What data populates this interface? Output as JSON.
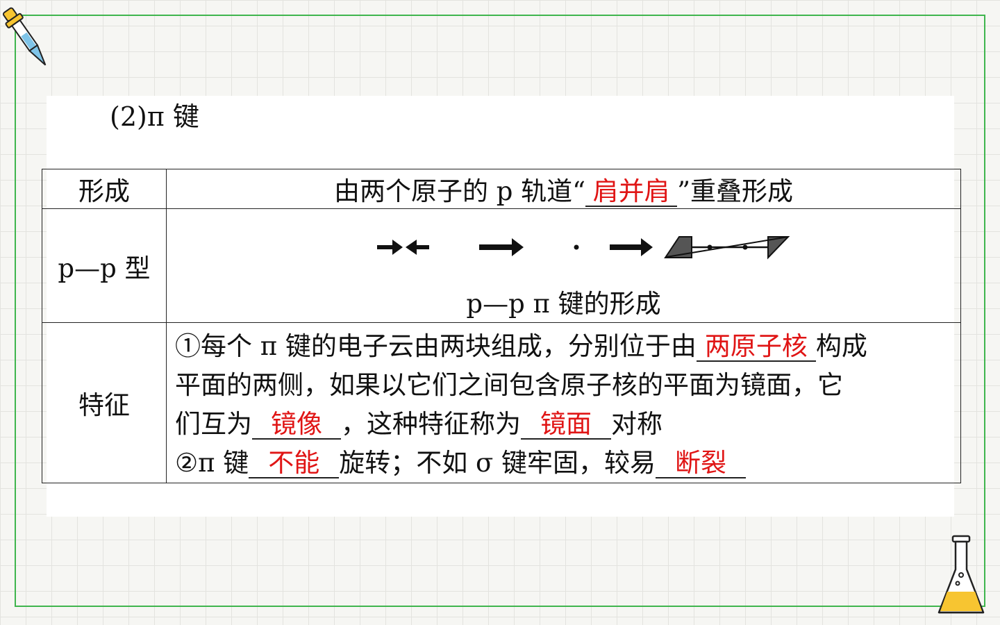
{
  "section": {
    "title": "(2)π 键"
  },
  "table": {
    "row_formation": {
      "header": "形成",
      "text_before": "由两个原子的 p 轨道“",
      "blank": "肩并肩",
      "text_after": "”重叠形成"
    },
    "row_pp": {
      "header": "p—p 型",
      "caption": "p—p π 键的形成"
    },
    "row_features": {
      "header": "特征",
      "line1_before": "①每个 π 键的电子云由两块组成，分别位于由",
      "line1_blank": "两原子核",
      "line1_after": "构成",
      "line2": "平面的两侧，如果以它们之间包含原子核的平面为镜面，它",
      "line3_before": "们互为",
      "line3_blank1": "镜像",
      "line3_mid": "，这种特征称为",
      "line3_blank2": "镜面",
      "line3_after": "对称",
      "line4_before": "②π 键",
      "line4_blank1": "不能",
      "line4_mid": "旋转；不如 σ 键牢固，较易",
      "line4_blank2": "断裂"
    }
  },
  "colors": {
    "border_green": "#3fb54d",
    "answer_red": "#e01515",
    "flask_liquid": "#f7c531",
    "dropper_blue": "#7fc4e8"
  },
  "icons": [
    "dropper-icon",
    "flask-icon"
  ]
}
